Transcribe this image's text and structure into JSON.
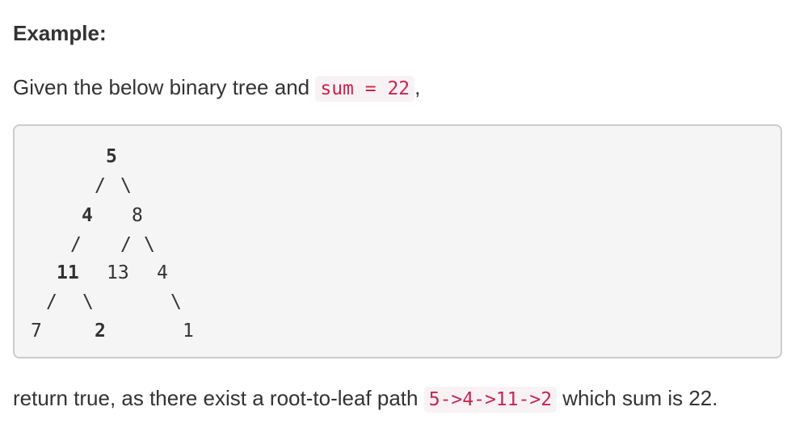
{
  "heading": "Example:",
  "intro": {
    "prefix": "Given the below binary tree and",
    "code": "sum = 22",
    "suffix": ","
  },
  "tree": {
    "nodes": {
      "root": "5",
      "left": "4",
      "right": "8",
      "left_left": "11",
      "right_left": "13",
      "right_right": "4",
      "leaf_7": "7",
      "leaf_2": "2",
      "leaf_1": "1"
    },
    "edges": {
      "slash": "/",
      "backslash": "\\"
    }
  },
  "conclusion": {
    "prefix": "return true, as there exist a root-to-leaf path",
    "code": "5->4->11->2",
    "suffix": "which sum is 22."
  }
}
